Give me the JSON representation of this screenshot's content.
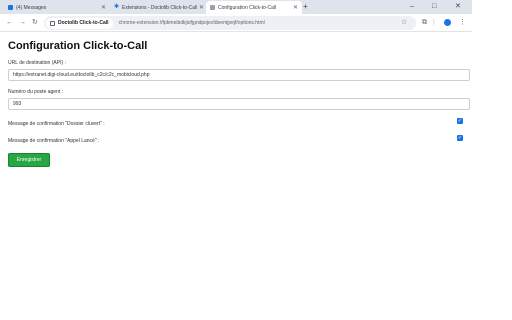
{
  "browser": {
    "tabs": [
      {
        "title": "(4) Messages",
        "active": false
      },
      {
        "title": "Extensions - Doctolib Click-to-Call",
        "active": false
      },
      {
        "title": "Configuration Click-to-Call",
        "active": true
      }
    ],
    "new_tab": "+",
    "window_controls": {
      "minimize": "–",
      "maximize": "□",
      "close": "✕"
    },
    "site_chip": "Doctolib Click-to-Call",
    "url": "chrome-extension://fpbmeibdkjiofjgndpojecfdeemjpejf/options.html"
  },
  "page": {
    "title": "Configuration Click-to-Call",
    "api_url": {
      "label": "URL de destination (API) :",
      "value": "https://extranet.digi-cloud.eu/doctolib_c2c/c2c_mobicloud.php"
    },
    "station_number": {
      "label": "Numéro du poste agent :",
      "value": "993"
    },
    "confirm_dossier": {
      "label": "Message de confirmation \"Dossier cluvert\" :",
      "checked": true
    },
    "confirm_appel": {
      "label": "Message de confirmation \"Appel Lancé\" :",
      "checked": true
    },
    "save_label": "Enregistrer"
  },
  "colors": {
    "tabbar_bg": "#dfe3eb",
    "accent": "#1a73e8",
    "save_button": "#28a745"
  }
}
